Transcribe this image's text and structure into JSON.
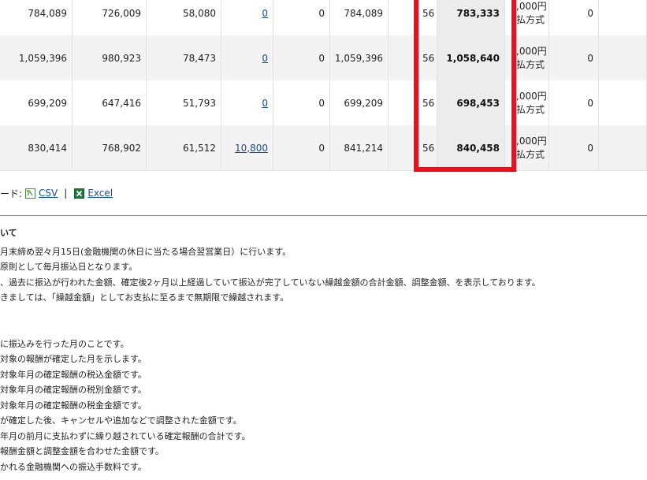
{
  "rows": [
    {
      "c1": "784,089",
      "c2": "726,009",
      "c3": "58,080",
      "c4": "0",
      "c5": "0",
      "c6": "784,089",
      "c7": "56",
      "c8": "783,333",
      "c9a": ",000円",
      "c9b": "払方式",
      "c10": "0"
    },
    {
      "c1": "1,059,396",
      "c2": "980,923",
      "c3": "78,473",
      "c4": "0",
      "c5": "0",
      "c6": "1,059,396",
      "c7": "56",
      "c8": "1,058,640",
      "c9a": ",000円",
      "c9b": "払方式",
      "c10": "0"
    },
    {
      "c1": "699,209",
      "c2": "647,416",
      "c3": "51,793",
      "c4": "0",
      "c5": "0",
      "c6": "699,209",
      "c7": "56",
      "c8": "698,453",
      "c9a": ",000円",
      "c9b": "払方式",
      "c10": "0"
    },
    {
      "c1": "830,414",
      "c2": "768,902",
      "c3": "61,512",
      "c4": "10,800",
      "c5": "0",
      "c6": "841,214",
      "c7": "56",
      "c8": "840,458",
      "c9a": ",000円",
      "c9b": "払方式",
      "c10": "0"
    }
  ],
  "download": {
    "prefix": "ード:",
    "csv": "CSV",
    "sep": "|",
    "excel": "Excel"
  },
  "notes": {
    "title": "いて",
    "lines1": [
      "月末締め翌々月15日(金融機関の休日に当たる場合翌営業日）に行います。",
      "原則として毎月振込日となります。",
      "、過去に振込が行われた金額、確定後2ヶ月以上経過していて振込が完了していない繰越金額の合計金額、調整金額、を表示しております。",
      "きましては、「繰越金額」としてお支払に至るまで無期限で繰越されます。"
    ],
    "lines2": [
      "に振込みを行った月のことです。",
      "対象の報酬が確定した月を示します。",
      "対象年月の確定報酬の税込金額です。",
      "対象年月の確定報酬の税別金額です。",
      "対象年月の確定報酬の税金金額です。",
      "が確定した後、キャンセルや追加などで調整された金額です。",
      "年月の前月に支払わずに繰り越されている確定報酬の合計です。",
      "報酬金額と調整金額を合わせた金額です。",
      "かれる金融機関への振込手数料です。"
    ]
  },
  "colors": {
    "highlight": "#e8121f",
    "link": "#1a4d8f",
    "rule": "#5a8fc7"
  }
}
